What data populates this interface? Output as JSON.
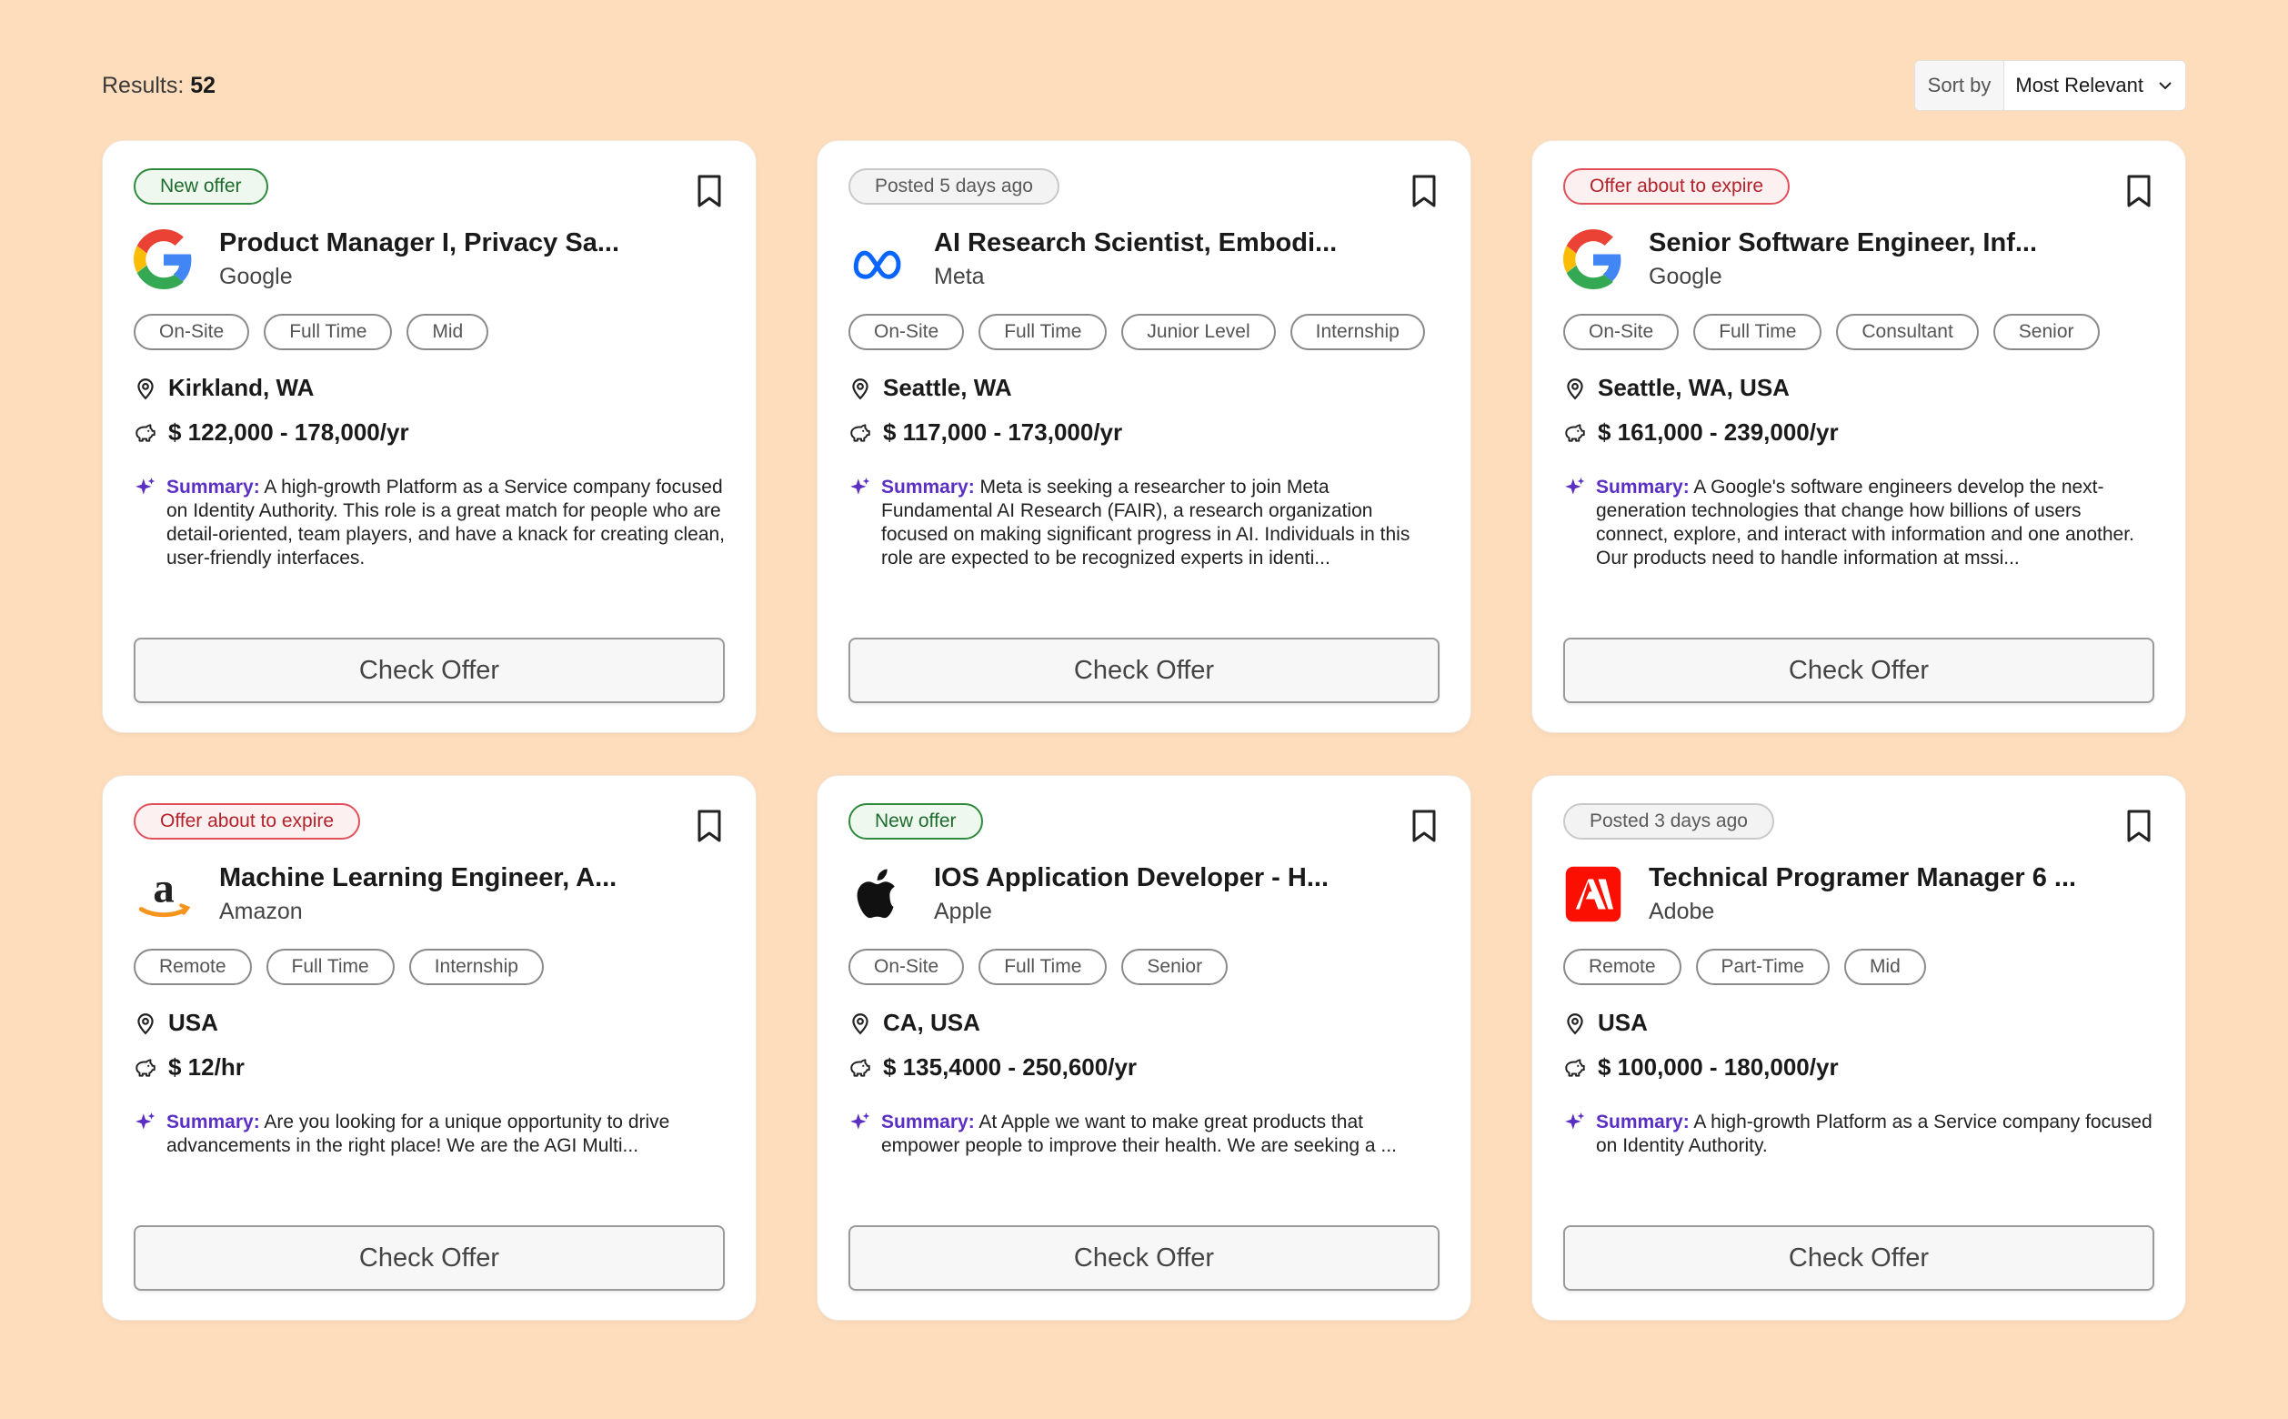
{
  "results": {
    "label": "Results:",
    "count": "52"
  },
  "sort": {
    "label": "Sort by",
    "value": "Most Relevant"
  },
  "summary_label": "Summary:",
  "check_offer_label": "Check Offer",
  "jobs": [
    {
      "badge": "New offer",
      "badge_type": "new",
      "title": "Product Manager I, Privacy Sa...",
      "company": "Google",
      "logo": "google-logo",
      "tags": [
        "On-Site",
        "Full Time",
        "Mid"
      ],
      "location": "Kirkland, WA",
      "salary": "$ 122,000 - 178,000/yr",
      "summary": "A high-growth Platform as a Service company focused on Identity Authority. This role is a great match for people who are detail-oriented, team players, and have a knack for creating clean, user-friendly interfaces."
    },
    {
      "badge": "Posted 5 days ago",
      "badge_type": "posted",
      "title": "AI Research Scientist, Embodi...",
      "company": "Meta",
      "logo": "meta-logo",
      "tags": [
        "On-Site",
        "Full Time",
        "Junior Level",
        "Internship"
      ],
      "location": "Seattle, WA",
      "salary": "$ 117,000 - 173,000/yr",
      "summary": "Meta is seeking a researcher to join Meta Fundamental AI Research (FAIR), a research organization focused on making significant progress in AI. Individuals in this role are expected to be recognized experts in identi..."
    },
    {
      "badge": "Offer about to expire",
      "badge_type": "expire",
      "title": "Senior Software Engineer, Inf...",
      "company": "Google",
      "logo": "google-logo",
      "tags": [
        "On-Site",
        "Full Time",
        "Consultant",
        "Senior"
      ],
      "location": "Seattle, WA, USA",
      "salary": "$ 161,000 - 239,000/yr",
      "summary": "A Google's software engineers develop the next-generation technologies that change how billions of users connect, explore, and interact with information and one another. Our products need to handle information at mssi..."
    },
    {
      "badge": "Offer about to expire",
      "badge_type": "expire",
      "title": "Machine Learning Engineer, A...",
      "company": "Amazon",
      "logo": "amazon-logo",
      "tags": [
        "Remote",
        "Full Time",
        "Internship"
      ],
      "location": "USA",
      "salary": "$ 12/hr",
      "summary": "Are you looking for a unique opportunity to drive advancements in the right place! We are the AGI Multi..."
    },
    {
      "badge": "New offer",
      "badge_type": "new",
      "title": "IOS Application Developer - H...",
      "company": "Apple",
      "logo": "apple-logo",
      "tags": [
        "On-Site",
        "Full Time",
        "Senior"
      ],
      "location": "CA, USA",
      "salary": "$ 135,4000 - 250,600/yr",
      "summary": "At Apple we want to make great products that empower people to improve their health. We are seeking a ..."
    },
    {
      "badge": "Posted 3 days ago",
      "badge_type": "posted",
      "title": "Technical Programer Manager 6 ...",
      "company": "Adobe",
      "logo": "adobe-logo",
      "tags": [
        "Remote",
        "Part-Time",
        "Mid"
      ],
      "location": "USA",
      "salary": "$ 100,000 - 180,000/yr",
      "summary": "A high-growth Platform as a Service company focused on Identity Authority."
    }
  ]
}
